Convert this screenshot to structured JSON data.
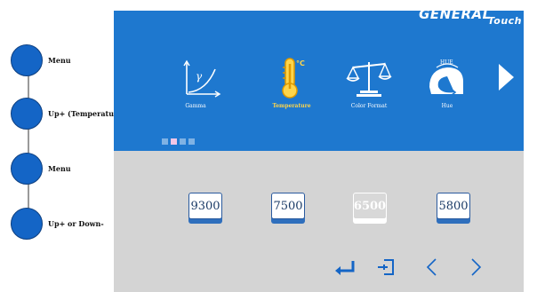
{
  "steps": [
    {
      "label": "Menu"
    },
    {
      "label": "Up+ (Temperature)"
    },
    {
      "label": "Menu"
    },
    {
      "label": "Up+ or Down-"
    }
  ],
  "brand": {
    "part1": "GENERAL",
    "part2": "Touch"
  },
  "menu": [
    {
      "label": "Gamma",
      "icon": "gamma-icon"
    },
    {
      "label": "Temperature",
      "icon": "thermometer-icon",
      "selected": true
    },
    {
      "label": "Color Format",
      "icon": "scale-icon"
    },
    {
      "label": "Hue",
      "icon": "hue-icon",
      "icon_text": "HUE"
    }
  ],
  "thermo_unit": "°C",
  "presets": [
    {
      "label": "9300"
    },
    {
      "label": "7500"
    },
    {
      "label": "6500",
      "selected": true
    },
    {
      "label": "5800"
    }
  ],
  "colors": {
    "panel_blue": "#1e78cf",
    "panel_gray": "#d4d4d4",
    "selected_text": "#ffd54a",
    "dot_blue": "#1465c6"
  }
}
